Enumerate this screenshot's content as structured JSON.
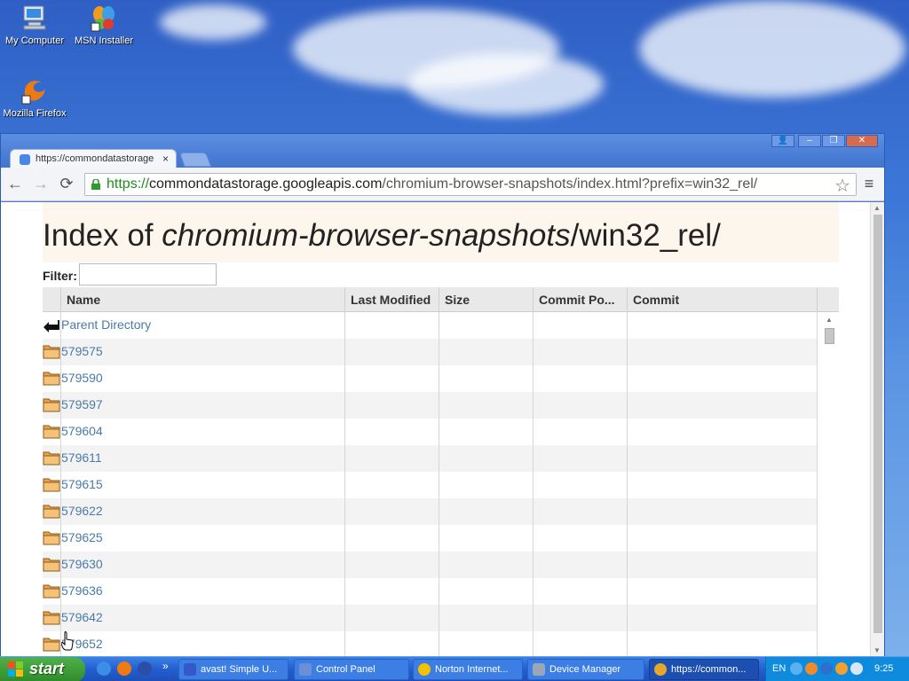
{
  "desktop": {
    "icons": [
      {
        "label": "My Computer"
      },
      {
        "label": "MSN Installer"
      },
      {
        "label": "Mozilla Firefox"
      }
    ]
  },
  "browser": {
    "tab_title": "https://commondatastorage",
    "tab_close": "×",
    "url_scheme": "https://",
    "url_host": "commondatastorage.googleapis.com",
    "url_path": "/chromium-browser-snapshots/index.html?prefix=win32_rel/",
    "back": "←",
    "forward": "→",
    "reload": "⟳",
    "star": "☆",
    "menu": "≡",
    "window_controls": {
      "user": "👤",
      "minimize": "–",
      "restore": "❐",
      "close": "✕"
    }
  },
  "page": {
    "title_prefix": "Index of ",
    "title_bucket": "chromium-browser-snapshots",
    "title_suffix": "/win32_rel/",
    "filter_label": "Filter:",
    "filter_value": "",
    "columns": [
      "Name",
      "Last Modified",
      "Size",
      "Commit Po...",
      "Commit"
    ],
    "rows": [
      {
        "name": "Parent Directory",
        "type": "parent"
      },
      {
        "name": "579575",
        "type": "folder"
      },
      {
        "name": "579590",
        "type": "folder"
      },
      {
        "name": "579597",
        "type": "folder"
      },
      {
        "name": "579604",
        "type": "folder"
      },
      {
        "name": "579611",
        "type": "folder"
      },
      {
        "name": "579615",
        "type": "folder"
      },
      {
        "name": "579622",
        "type": "folder"
      },
      {
        "name": "579625",
        "type": "folder"
      },
      {
        "name": "579630",
        "type": "folder"
      },
      {
        "name": "579636",
        "type": "folder"
      },
      {
        "name": "579642",
        "type": "folder"
      },
      {
        "name": "579652",
        "type": "folder"
      }
    ]
  },
  "taskbar": {
    "start_label": "start",
    "quick_more": "»",
    "tasks": [
      {
        "label": "avast! Simple U...",
        "color": "#3558c8"
      },
      {
        "label": "Control Panel",
        "color": "#6a8fd8"
      },
      {
        "label": "Norton Internet...",
        "color": "#f2c200"
      },
      {
        "label": "Device Manager",
        "color": "#9aa7b8"
      },
      {
        "label": "https://common...",
        "color": "#e5a72a"
      }
    ],
    "language": "EN",
    "clock": "9:25"
  },
  "colors": {
    "link": "#4a7aa8",
    "url_scheme": "#1f8c1f",
    "header_bg": "#fdf6ec",
    "taskbar": "#245ed1",
    "start": "#2f8b2a"
  }
}
